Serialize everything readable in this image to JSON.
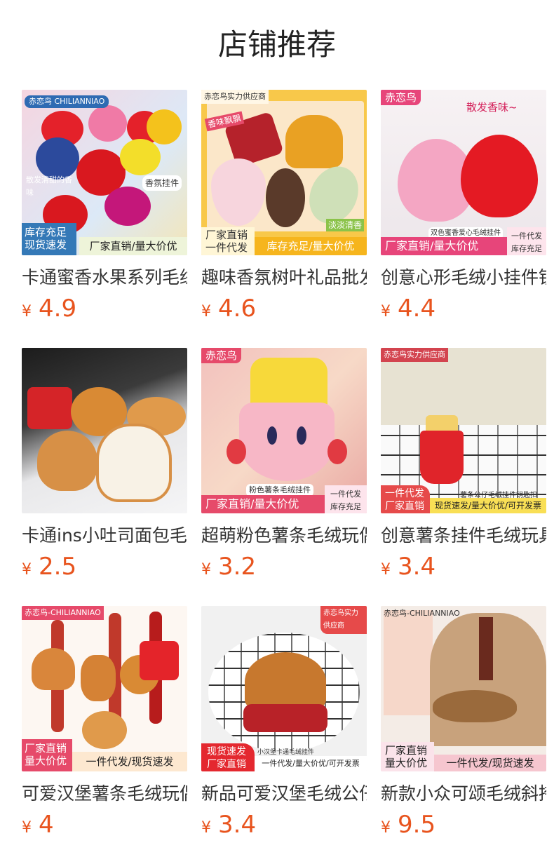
{
  "page_title": "店铺推荐",
  "currency": "¥",
  "accent": "#e8541e",
  "products": [
    {
      "name": "卡通蜜香水果系列毛绒",
      "price": "4.9",
      "overlay": {
        "brand": "赤恋鸟 CHILIANNIAO",
        "tag1": "香氛挂件",
        "tag2": "散发清甜的香味",
        "left": "库存充足\n现货速发",
        "right": "厂家直销/量大价优"
      }
    },
    {
      "name": "趣味香氛树叶礼品批发",
      "price": "4.6",
      "overlay": {
        "brand": "赤恋鸟实力供应商",
        "tag1": "香味飘飘",
        "tag2": "淡淡清香",
        "left": "厂家直销\n一件代发",
        "right": "库存充足/量大价优"
      }
    },
    {
      "name": "创意心形毛绒小挂件钥",
      "price": "4.4",
      "overlay": {
        "brand": "赤恋鸟",
        "tag1": "散发香味~",
        "tag2": "双色蜜香爱心毛绒挂件",
        "left": "厂家直销/量大价优",
        "right": "一件代发\n库存充足"
      }
    },
    {
      "name": "卡通ins小吐司面包毛绒",
      "price": "2.5",
      "overlay": {
        "brand": "",
        "tag1": "",
        "tag2": "",
        "left": "",
        "right": ""
      }
    },
    {
      "name": "超萌粉色薯条毛绒玩偶",
      "price": "3.2",
      "overlay": {
        "brand": "赤恋鸟",
        "tag1": "粉色薯条毛绒挂件",
        "tag2": "",
        "left": "厂家直销/量大价优",
        "right": "一件代发\n库存充足"
      }
    },
    {
      "name": "创意薯条挂件毛绒玩具",
      "price": "3.4",
      "overlay": {
        "brand": "赤恋鸟实力供应商",
        "tag1": "薯条公仔毛绒挂件钥匙扣",
        "tag2": "",
        "left": "一件代发\n厂家直销",
        "right": "现货速发/量大价优/可开发票"
      }
    },
    {
      "name": "可爱汉堡薯条毛绒玩偶",
      "price": "4",
      "overlay": {
        "brand": "赤恋鸟-CHILIANNIAO",
        "tag1": "",
        "tag2": "",
        "left": "厂家直销\n量大价优",
        "right": "一件代发/现货速发"
      }
    },
    {
      "name": "新品可爱汉堡毛绒公仔",
      "price": "3.4",
      "overlay": {
        "brand": "赤恋鸟实力供应商",
        "tag1": "小汉堡卡通毛绒挂件",
        "tag2": "",
        "left": "现货速发\n厂家直销",
        "right": "一件代发/量大价优/可开发票"
      }
    },
    {
      "name": "新款小众可颂毛绒斜挎",
      "price": "9.5",
      "overlay": {
        "brand": "赤恋鸟-CHILIANNIAO",
        "tag1": "",
        "tag2": "",
        "left": "厂家直销\n量大价优",
        "right": "一件代发/现货速发"
      }
    }
  ]
}
